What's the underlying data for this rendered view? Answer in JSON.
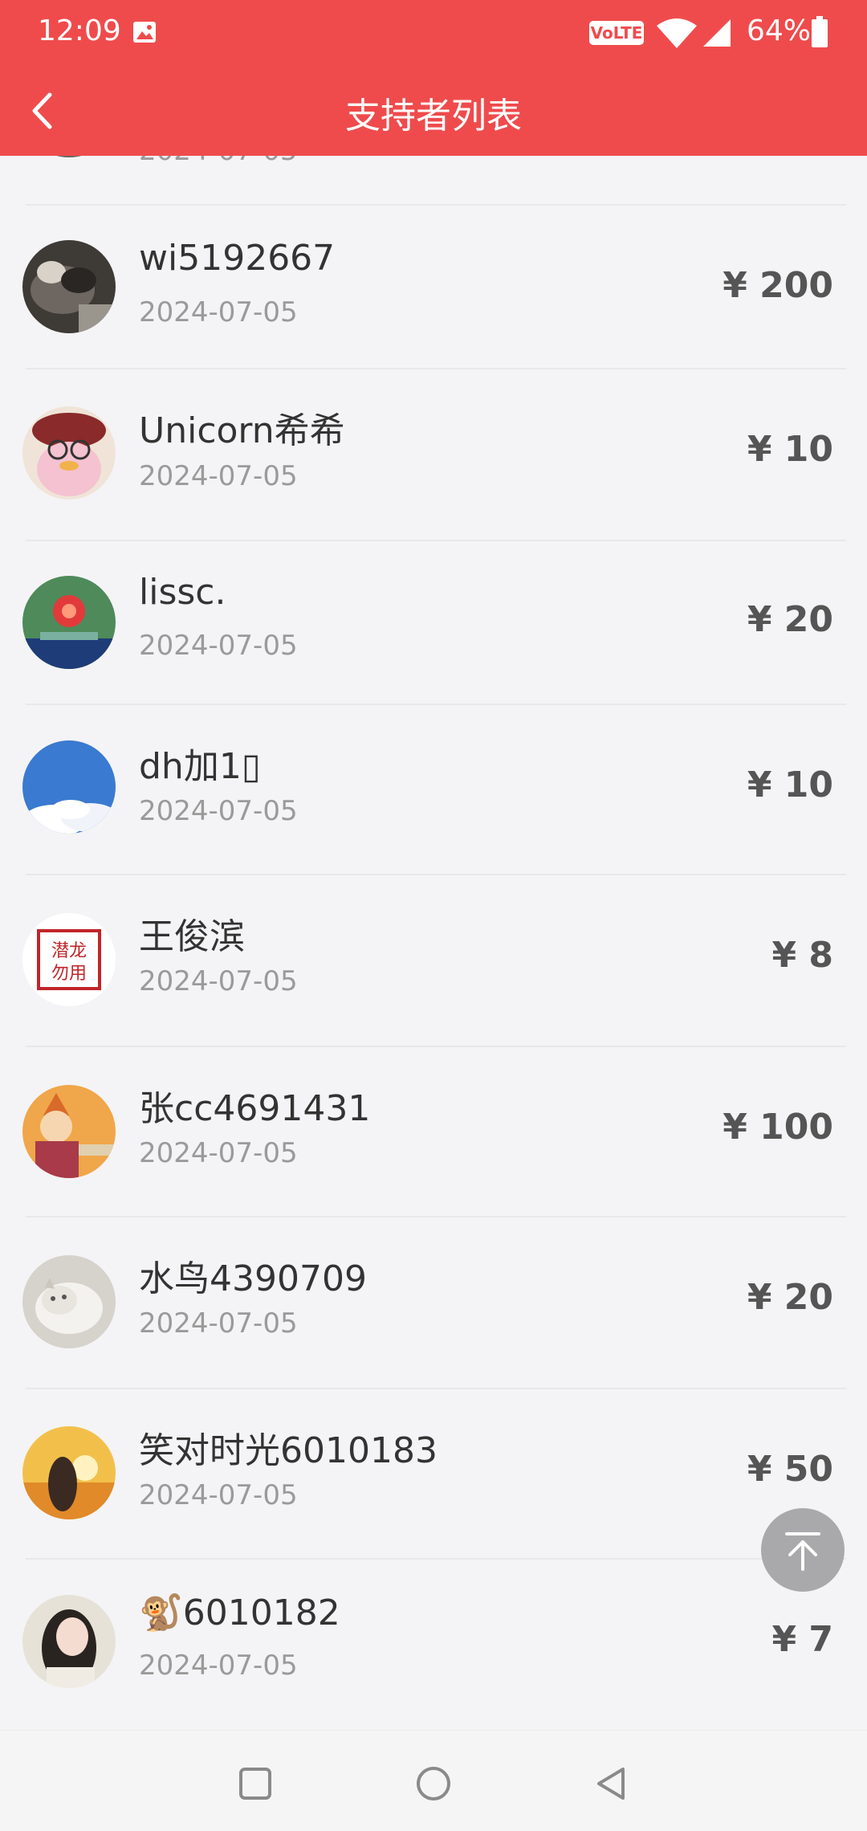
{
  "status_bar": {
    "time": "12:09",
    "network_badge": "VoLTE",
    "battery": "64%",
    "icons": [
      "gallery-icon",
      "wifi-icon",
      "signal-icon",
      "battery-icon"
    ]
  },
  "header": {
    "title": "支持者列表",
    "back_icon": "chevron-left-icon",
    "background_color": "#ef4b4c"
  },
  "supporters": [
    {
      "name": "",
      "date": "2024-07-05",
      "amount": ""
    },
    {
      "name": "wi5192667",
      "date": "2024-07-05",
      "amount": "¥ 200"
    },
    {
      "name": "Unicorn希希",
      "date": "2024-07-05",
      "amount": "¥ 10"
    },
    {
      "name": "lissc.",
      "date": "2024-07-05",
      "amount": "¥ 20"
    },
    {
      "name": "dh加1▯",
      "date": "2024-07-05",
      "amount": "¥ 10"
    },
    {
      "name": "王俊滨",
      "date": "2024-07-05",
      "amount": "¥ 8"
    },
    {
      "name": "张cc4691431",
      "date": "2024-07-05",
      "amount": "¥ 100"
    },
    {
      "name": "水鸟4390709",
      "date": "2024-07-05",
      "amount": "¥ 20"
    },
    {
      "name": "笑对时光6010183",
      "date": "2024-07-05",
      "amount": "¥ 50"
    },
    {
      "name": "🐒6010182",
      "date": "2024-07-05",
      "amount": "¥ 7"
    }
  ],
  "back_to_top": {
    "icon": "arrow-up-to-top-icon"
  },
  "system_nav": {
    "icons": [
      "recent-apps-icon",
      "home-icon",
      "back-triangle-icon"
    ]
  }
}
